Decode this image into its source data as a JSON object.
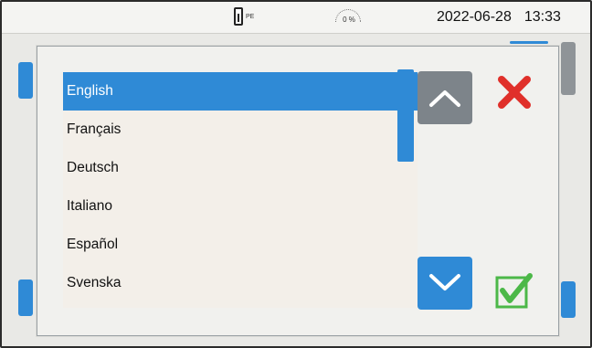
{
  "status": {
    "pe_label": "PE",
    "memory_percent": "0 %",
    "date": "2022-06-28",
    "time": "13:33",
    "battery_icon": "battery-icon"
  },
  "language_dialog": {
    "languages": [
      "English",
      "Français",
      "Deutsch",
      "Italiano",
      "Español",
      "Svenska"
    ],
    "selected_index": 0,
    "icons": {
      "up": "chevron-up-icon",
      "down": "chevron-down-icon",
      "cancel": "close-icon",
      "confirm": "checkbox-check-icon"
    }
  },
  "colors": {
    "accent": "#2f8ad6",
    "cancel": "#e0302a",
    "confirm": "#4cb848",
    "disabled_button": "#7d848a"
  }
}
